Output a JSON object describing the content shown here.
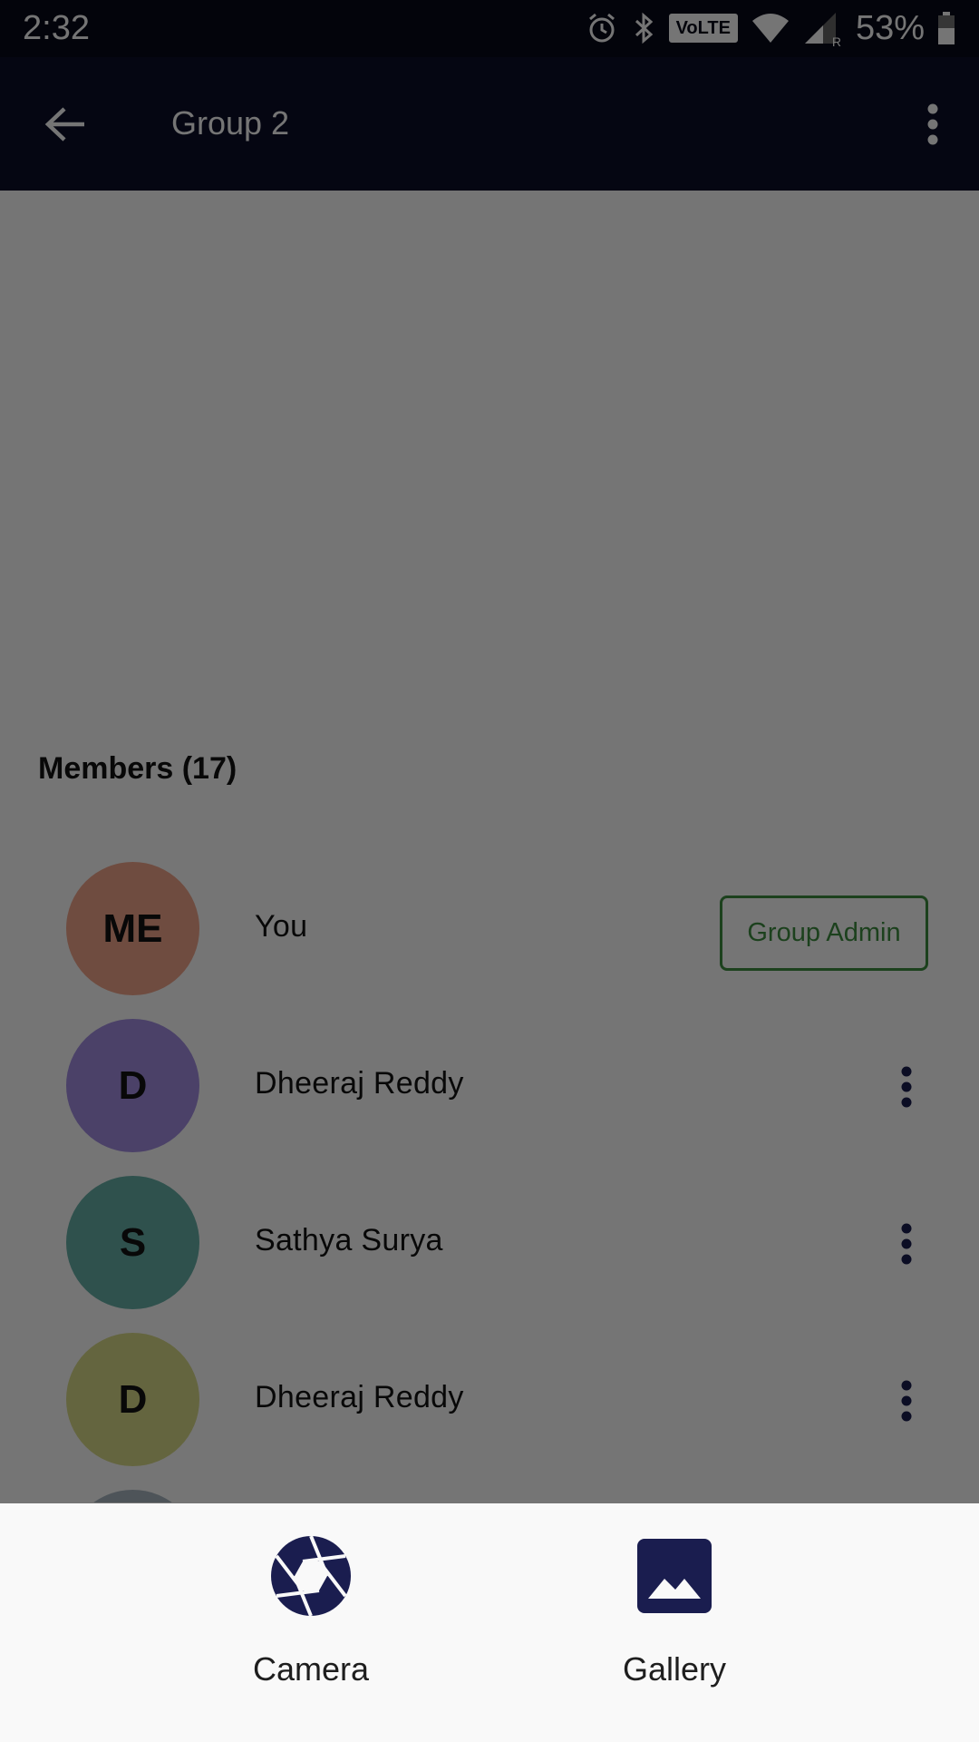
{
  "status_bar": {
    "time": "2:32",
    "volte": "VoLTE",
    "roaming": "R",
    "battery": "53%"
  },
  "app_bar": {
    "title": "Group 2",
    "back_icon": "arrow-back-icon",
    "menu_icon": "more-vert-icon"
  },
  "members": {
    "title": "Members (17)",
    "items": [
      {
        "initials": "ME",
        "name": "You",
        "color": "#f2a58b",
        "role": "Group Admin"
      },
      {
        "initials": "D",
        "name": "Dheeraj  Reddy",
        "color": "#a38ee3"
      },
      {
        "initials": "S",
        "name": "Sathya  Surya",
        "color": "#66b0a8"
      },
      {
        "initials": "D",
        "name": "Dheeraj  Reddy",
        "color": "#dbdc8a"
      },
      {
        "initials": "",
        "name": "",
        "color": "#aab8c2"
      }
    ]
  },
  "bottom_sheet": {
    "camera_label": "Camera",
    "gallery_label": "Gallery",
    "icon_color": "#1a1d4f"
  },
  "colors": {
    "status_bar": "#080a18",
    "app_bar": "#0c0f28",
    "admin_green": "#3e8e41",
    "scrim": "rgba(0,0,0,0.54)"
  }
}
